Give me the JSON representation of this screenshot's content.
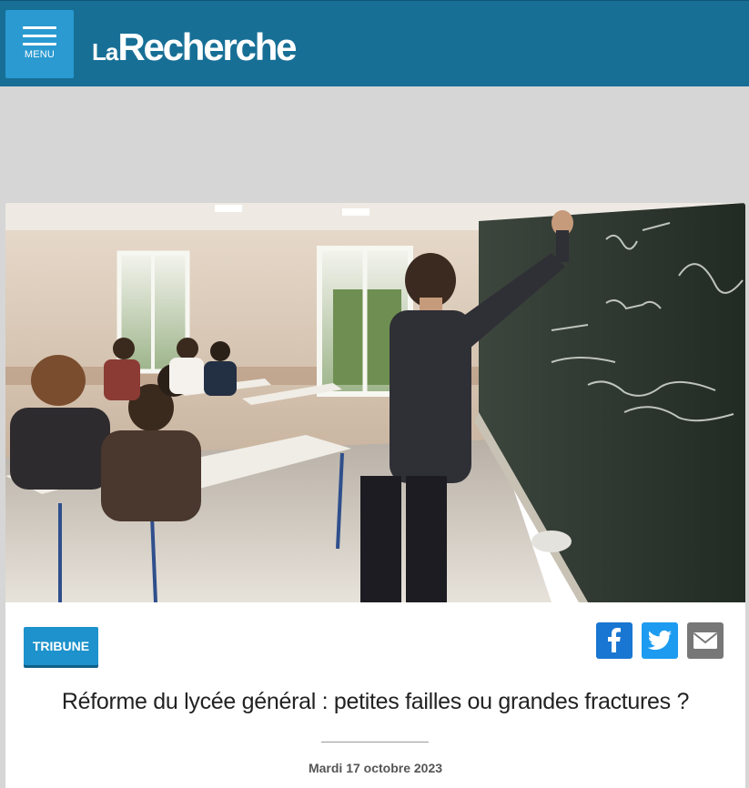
{
  "header": {
    "menu_label": "MENU",
    "logo_prefix": "La",
    "logo_main": "Recherche",
    "background": "#176f96",
    "menu_color": "#2a9ad1"
  },
  "article": {
    "hero_image": "classroom-student-writing-on-blackboard",
    "category": "TRIBUNE",
    "title": "Réforme du lycée général : petites failles ou grandes fractures ?",
    "date": "Mardi 17 octobre 2023"
  },
  "share": {
    "items": [
      {
        "name": "facebook-icon",
        "color": "#1976d2"
      },
      {
        "name": "twitter-icon",
        "color": "#1d9bf0"
      },
      {
        "name": "email-icon",
        "color": "#777777"
      }
    ]
  }
}
